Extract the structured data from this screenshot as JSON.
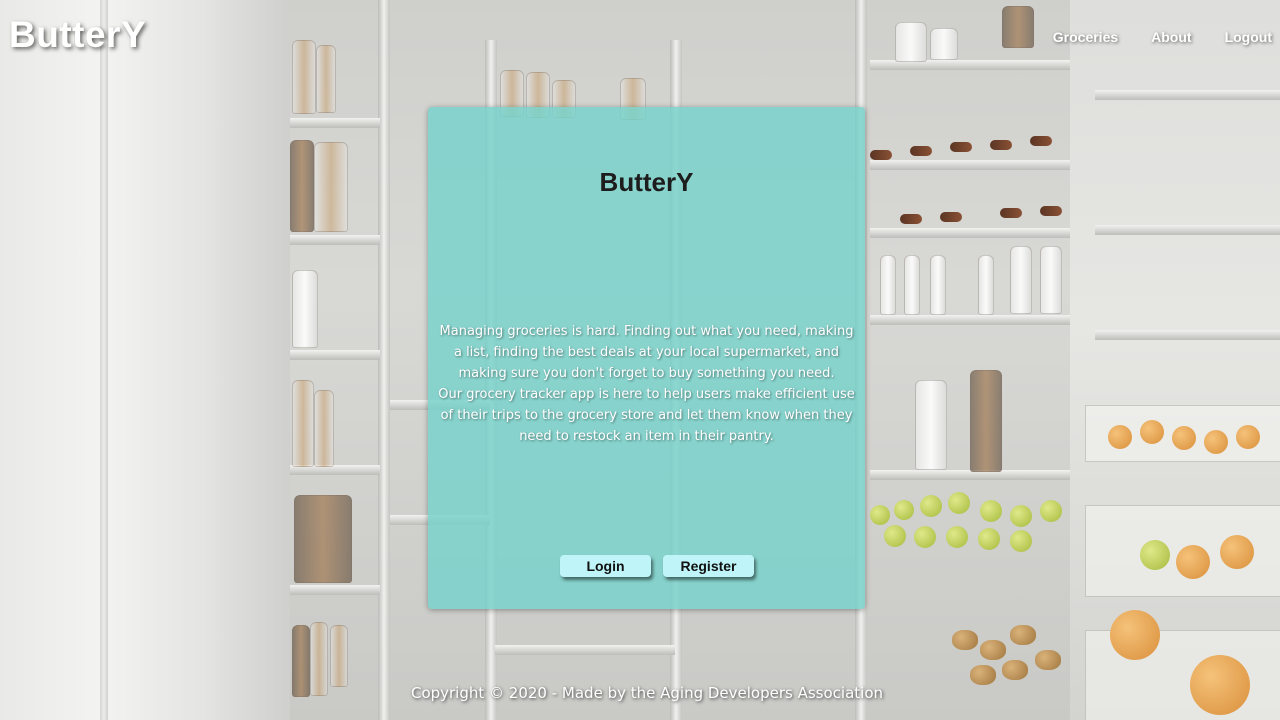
{
  "header": {
    "brand": "ButterY",
    "nav": [
      "Groceries",
      "About",
      "Logout"
    ]
  },
  "card": {
    "title": "ButterY",
    "description": [
      "Managing groceries is hard. Finding out what you need, making a list, finding the best deals at your local supermarket, and making sure you don't forget to buy something you need.",
      "Our grocery tracker app is here to help users make efficient use of their trips to the grocery store and let them know when they need to restock an item in their pantry."
    ],
    "login_label": "Login",
    "register_label": "Register"
  },
  "footer": {
    "text": "Copyright © 2020 - Made by the Aging Developers Association"
  },
  "colors": {
    "card_background": "#76d2ca",
    "button_background": "#bff5f8",
    "text_light": "#ffffff",
    "title_dark": "#1d1d1d"
  }
}
